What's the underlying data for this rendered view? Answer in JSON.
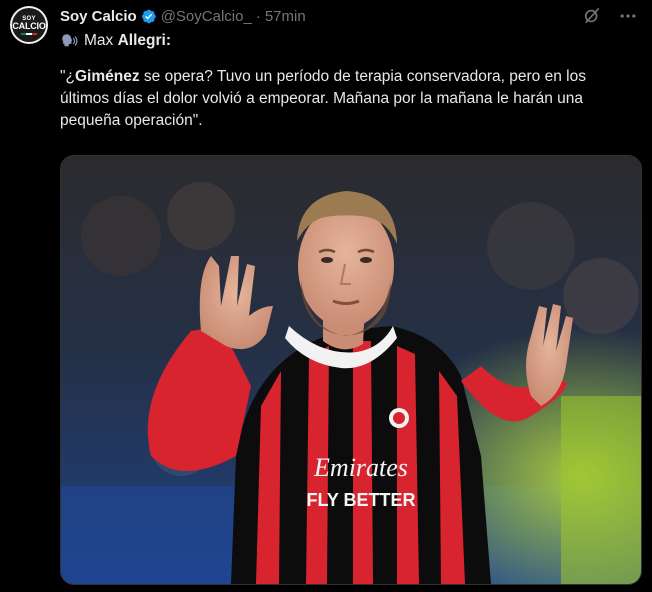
{
  "author": {
    "display_name": "Soy Calcio",
    "handle": "@SoyCalcio_",
    "separator": "·",
    "time": "57min",
    "avatar": {
      "top_text": "SOY",
      "main_text": "CALCIO"
    },
    "verified": true
  },
  "tweet": {
    "speaker_prefix": "Max ",
    "speaker_name": "Allegri",
    "speaker_suffix": ":",
    "quote_open": "\"¿",
    "quote_bold": "Giménez",
    "quote_line1_rest": " se opera? Tuvo un período de terapia conservadora, pero en los",
    "quote_line2": "últimos días el dolor volvió a empeorar. Mañana por la mañana le harán una",
    "quote_line3": "pequeña operación\"."
  },
  "media": {
    "shirt_sponsor_line1": "Emirates",
    "shirt_sponsor_line2": "FLY BETTER"
  },
  "colors": {
    "background": "#000000",
    "text": "#e7e9ea",
    "secondary_text": "#71767b",
    "verified": "#1d9bf0",
    "milan_red": "#d7242f",
    "milan_black": "#0c0c0c"
  },
  "icons": {
    "verified": "verified-badge-icon",
    "grok": "grok-icon",
    "more": "more-options-icon",
    "speaking": "speaking-head-icon"
  }
}
